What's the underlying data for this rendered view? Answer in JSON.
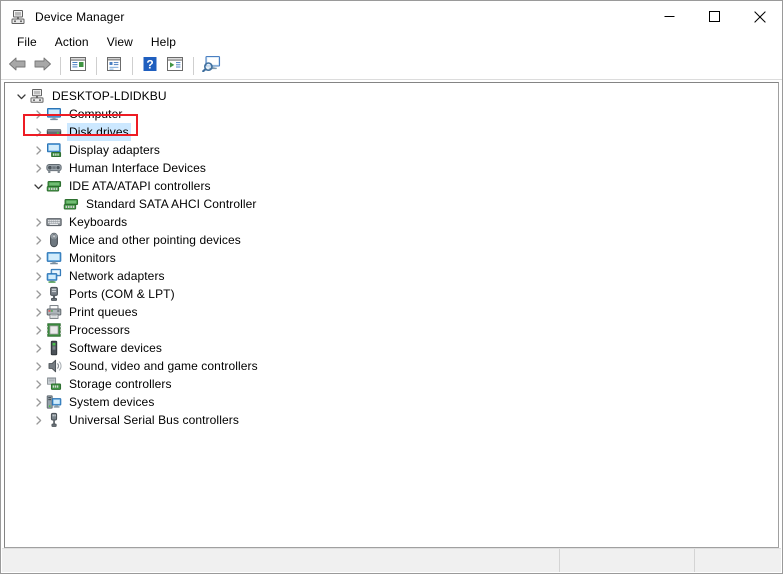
{
  "window": {
    "title": "Device Manager",
    "title_icon": "device-manager-icon",
    "controls": {
      "minimize_label": "Minimize",
      "maximize_label": "Maximize",
      "close_label": "Close"
    }
  },
  "menubar": {
    "items": [
      {
        "label": "File"
      },
      {
        "label": "Action"
      },
      {
        "label": "View"
      },
      {
        "label": "Help"
      }
    ]
  },
  "toolbar": {
    "buttons": [
      {
        "name": "back-button",
        "icon": "back-arrow-icon",
        "label": "Back"
      },
      {
        "name": "forward-button",
        "icon": "forward-arrow-icon",
        "label": "Forward"
      },
      {
        "name": "show-hide-console-tree-button",
        "icon": "console-tree-icon",
        "label": "Show/Hide Console Tree"
      },
      {
        "name": "properties-button",
        "icon": "properties-icon",
        "label": "Properties"
      },
      {
        "name": "help-button",
        "icon": "help-question-icon",
        "label": "Help"
      },
      {
        "name": "update-driver-button",
        "icon": "update-driver-icon",
        "label": "Update Driver Software"
      },
      {
        "name": "scan-for-hardware-changes-button",
        "icon": "scan-monitor-icon",
        "label": "Scan for hardware changes"
      }
    ]
  },
  "tree": {
    "root": {
      "label": "DESKTOP-LDIDKBU",
      "icon": "computer-root-icon",
      "expanded": true,
      "level": 0
    },
    "nodes": [
      {
        "label": "Computer",
        "icon": "computer-icon",
        "expanded": false,
        "level": 1,
        "selected": false
      },
      {
        "label": "Disk drives",
        "icon": "disk-drive-icon",
        "expanded": false,
        "level": 1,
        "selected": true
      },
      {
        "label": "Display adapters",
        "icon": "display-adapter-icon",
        "expanded": false,
        "level": 1,
        "selected": false
      },
      {
        "label": "Human Interface Devices",
        "icon": "hid-icon",
        "expanded": false,
        "level": 1,
        "selected": false
      },
      {
        "label": "IDE ATA/ATAPI controllers",
        "icon": "ide-controller-icon",
        "expanded": true,
        "level": 1,
        "selected": false
      },
      {
        "label": "Standard SATA AHCI Controller",
        "icon": "ide-controller-icon",
        "expanded": null,
        "level": 2,
        "selected": false
      },
      {
        "label": "Keyboards",
        "icon": "keyboard-icon",
        "expanded": false,
        "level": 1,
        "selected": false
      },
      {
        "label": "Mice and other pointing devices",
        "icon": "mouse-icon",
        "expanded": false,
        "level": 1,
        "selected": false
      },
      {
        "label": "Monitors",
        "icon": "monitor-icon",
        "expanded": false,
        "level": 1,
        "selected": false
      },
      {
        "label": "Network adapters",
        "icon": "network-adapter-icon",
        "expanded": false,
        "level": 1,
        "selected": false
      },
      {
        "label": "Ports (COM & LPT)",
        "icon": "port-icon",
        "expanded": false,
        "level": 1,
        "selected": false
      },
      {
        "label": "Print queues",
        "icon": "printer-icon",
        "expanded": false,
        "level": 1,
        "selected": false
      },
      {
        "label": "Processors",
        "icon": "processor-icon",
        "expanded": false,
        "level": 1,
        "selected": false
      },
      {
        "label": "Software devices",
        "icon": "software-device-icon",
        "expanded": false,
        "level": 1,
        "selected": false
      },
      {
        "label": "Sound, video and game controllers",
        "icon": "speaker-icon",
        "expanded": false,
        "level": 1,
        "selected": false
      },
      {
        "label": "Storage controllers",
        "icon": "storage-controller-icon",
        "expanded": false,
        "level": 1,
        "selected": false
      },
      {
        "label": "System devices",
        "icon": "system-device-icon",
        "expanded": false,
        "level": 1,
        "selected": false
      },
      {
        "label": "Universal Serial Bus controllers",
        "icon": "usb-controller-icon",
        "expanded": false,
        "level": 1,
        "selected": false
      }
    ]
  },
  "annotation": {
    "target_label": "Disk drives",
    "color": "#ee1c24"
  },
  "statusbar": {
    "panel_main": "",
    "panel_two": "",
    "panel_three": ""
  },
  "colors": {
    "selection": "#cce8ff",
    "annotation": "#ee1c24",
    "window_border": "#9a9a9a",
    "toolbar_icon_blue": "#1f5fbf",
    "statusbar_bg": "#f0f0f0"
  }
}
